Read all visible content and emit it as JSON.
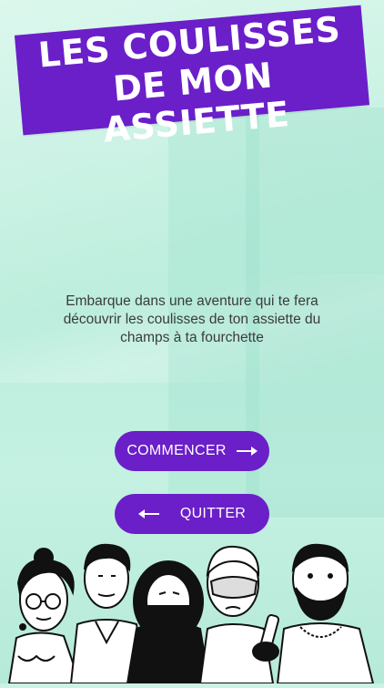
{
  "title": {
    "line1": "LES COULISSES",
    "line2": "DE MON ASSIETTE"
  },
  "intro": {
    "text": "Embarque dans une aventure qui te fera découvrir les coulisses de ton assiette du champs à ta fourchette"
  },
  "buttons": {
    "start_label": "COMMENCER",
    "start_icon": "arrow-right-icon",
    "quit_label": "QUITTER",
    "quit_icon": "arrow-left-icon"
  },
  "colors": {
    "accent": "#6a1fc9",
    "background": "#c4f1e2"
  },
  "illustration": {
    "subject": "five cartoon characters"
  }
}
